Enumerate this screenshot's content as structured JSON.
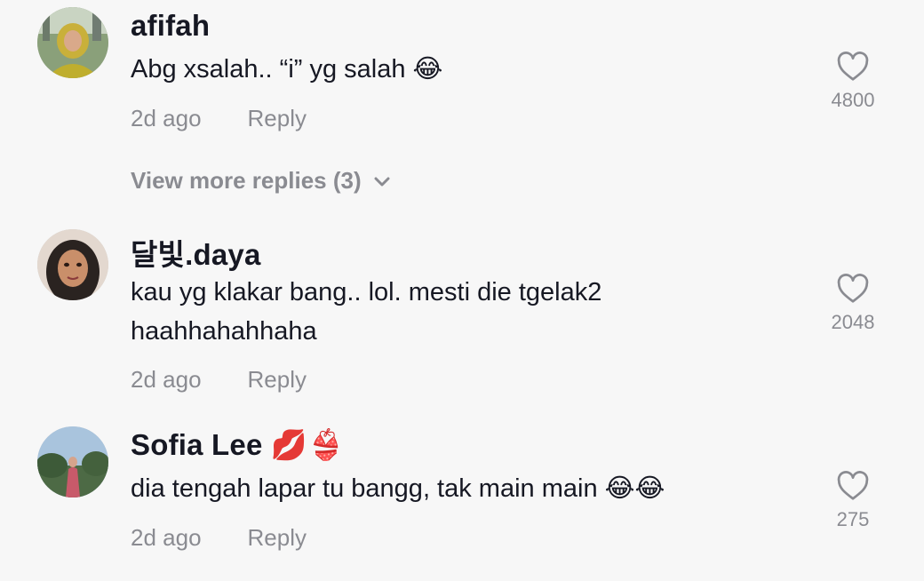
{
  "comments": [
    {
      "username": "afifah",
      "text": "Abg xsalah.. “i” yg salah 😂",
      "time": "2d ago",
      "reply_label": "Reply",
      "likes": "4800",
      "avatar_icon": "user-avatar-hijab-yellow"
    },
    {
      "username": "달빛.daya",
      "text": "kau yg klakar bang.. lol. mesti die tgelak2 haahhahahhaha",
      "time": "2d ago",
      "reply_label": "Reply",
      "likes": "2048",
      "avatar_icon": "user-avatar-cartoon"
    },
    {
      "username": "Sofia Lee 💋👙",
      "text": "dia tengah lapar tu bangg, tak main main 😂😂",
      "time": "2d ago",
      "reply_label": "Reply",
      "likes": "275",
      "avatar_icon": "user-avatar-outdoor"
    }
  ],
  "view_more_replies": "View more replies (3)",
  "colors": {
    "background": "#f7f7f7",
    "primary_text": "#161823",
    "secondary_text": "#8a8b91"
  }
}
